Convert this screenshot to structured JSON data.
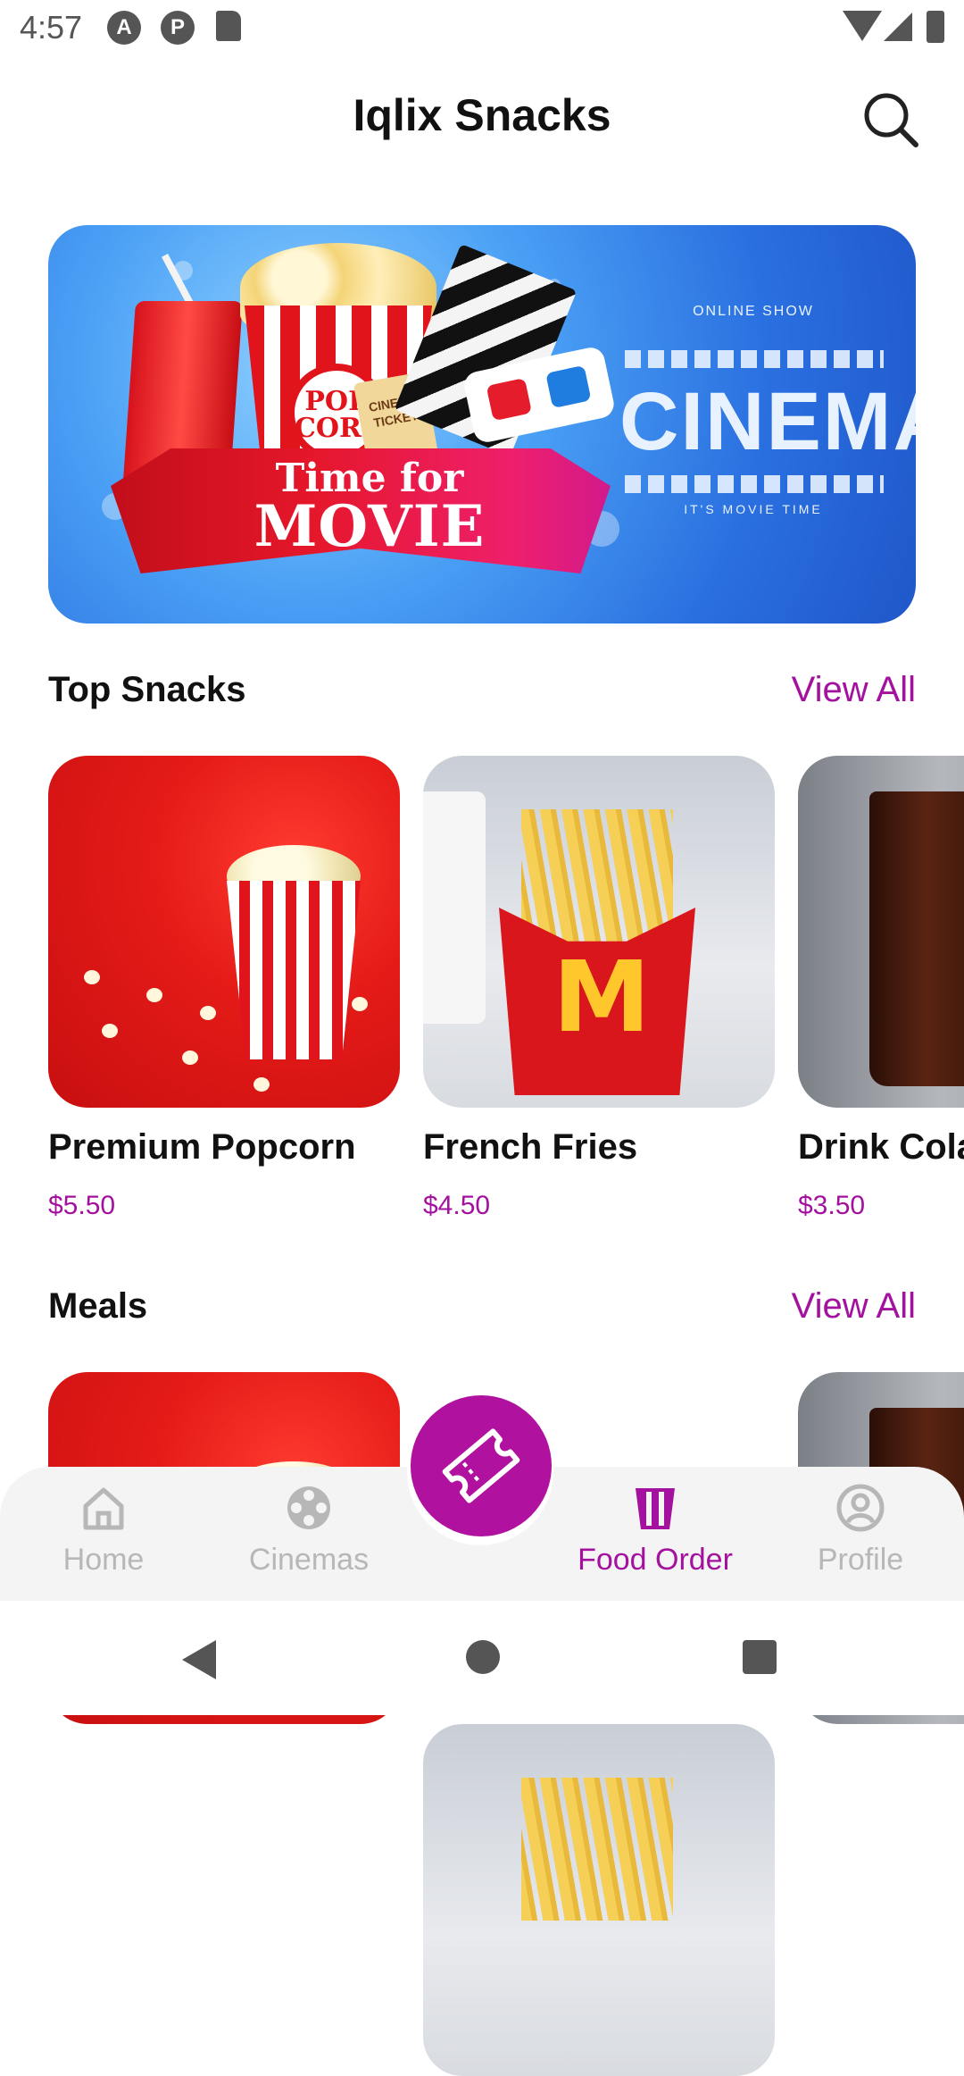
{
  "status_bar": {
    "time": "4:57"
  },
  "header": {
    "title": "Iqlix Snacks"
  },
  "banner": {
    "ribbon_line1": "Time for",
    "ribbon_line2": "MOVIE",
    "badge_top": "ONLINE SHOW",
    "headline": "CINEMA",
    "badge_bottom": "IT'S MOVIE TIME",
    "popcorn_label": "POP CORN",
    "ticket_label": "CINEMA TICKET"
  },
  "top_snacks": {
    "title": "Top Snacks",
    "view_all": "View All",
    "items": [
      {
        "name": "Premium Popcorn",
        "price": "$5.50"
      },
      {
        "name": "French Fries",
        "price": "$4.50"
      },
      {
        "name": "Drink Cola",
        "price": "$3.50"
      }
    ]
  },
  "meals": {
    "title": "Meals",
    "view_all": "View All"
  },
  "bottom_nav": {
    "items": [
      {
        "label": "Home",
        "icon": "home-icon"
      },
      {
        "label": "Cinemas",
        "icon": "film-reel-icon"
      },
      {
        "label": "Food Order",
        "icon": "popcorn-icon",
        "active": true
      },
      {
        "label": "Profile",
        "icon": "profile-icon"
      }
    ],
    "fab_icon": "ticket-icon"
  },
  "colors": {
    "accent": "#a3119e",
    "fab": "#b0119f",
    "nav_bg": "#f4f4f4",
    "inactive": "#b7b7b7"
  }
}
